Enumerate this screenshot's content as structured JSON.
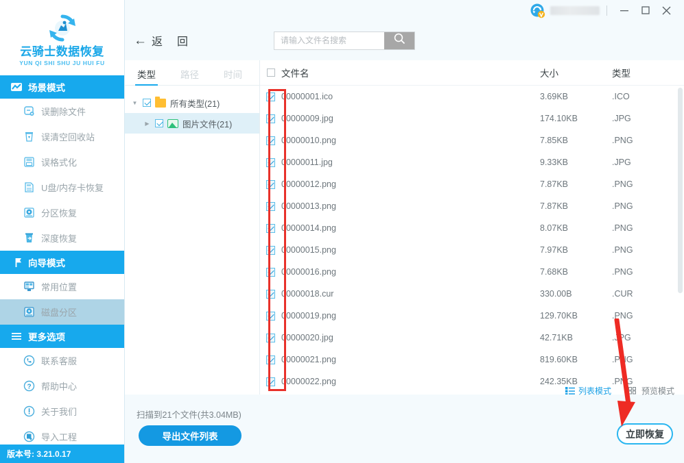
{
  "app": {
    "logo_title": "云骑士数据恢复",
    "logo_subtitle": "YUN QI SHI SHU JU HUI FU",
    "version": "版本号: 3.21.0.17"
  },
  "titlebar": {
    "minimize": "—",
    "maximize": "□",
    "close": "✕"
  },
  "sidebar": {
    "groups": [
      {
        "label": "场景模式",
        "icon": "scene-mode-icon",
        "items": [
          {
            "label": "误删除文件",
            "icon": "deleted-file-icon",
            "selected": false
          },
          {
            "label": "误清空回收站",
            "icon": "recycle-bin-icon",
            "selected": false
          },
          {
            "label": "误格式化",
            "icon": "format-icon",
            "selected": false
          },
          {
            "label": "U盘/内存卡恢复",
            "icon": "usb-card-icon",
            "selected": false
          },
          {
            "label": "分区恢复",
            "icon": "partition-recovery-icon",
            "selected": false
          },
          {
            "label": "深度恢复",
            "icon": "deep-recovery-icon",
            "selected": false
          }
        ]
      },
      {
        "label": "向导模式",
        "icon": "wizard-mode-icon",
        "items": [
          {
            "label": "常用位置",
            "icon": "common-location-icon",
            "selected": false
          },
          {
            "label": "磁盘分区",
            "icon": "disk-partition-icon",
            "selected": true
          }
        ]
      },
      {
        "label": "更多选项",
        "icon": "hamburger-icon",
        "items": [
          {
            "label": "联系客服",
            "icon": "phone-icon",
            "selected": false
          },
          {
            "label": "帮助中心",
            "icon": "question-icon",
            "selected": false
          },
          {
            "label": "关于我们",
            "icon": "info-icon",
            "selected": false
          },
          {
            "label": "导入工程",
            "icon": "import-project-icon",
            "selected": false
          }
        ]
      }
    ]
  },
  "toolbar": {
    "back_label": "返",
    "back_label2": "回",
    "search_placeholder": "请输入文件名搜索",
    "search_value": ""
  },
  "tree": {
    "tabs": [
      {
        "label": "类型",
        "active": true
      },
      {
        "label": "路径",
        "active": false
      },
      {
        "label": "时间",
        "active": false
      }
    ],
    "nodes": [
      {
        "label": "所有类型(21)",
        "level": 1,
        "icon": "folder-icon",
        "checked": true,
        "expanded": true,
        "selected": false
      },
      {
        "label": "图片文件(21)",
        "level": 2,
        "icon": "picture-icon",
        "checked": true,
        "expanded": false,
        "selected": true
      }
    ]
  },
  "filelist": {
    "columns": [
      "文件名",
      "大小",
      "类型"
    ],
    "header_checked": false,
    "rows": [
      {
        "name": "00000001.ico",
        "size": "3.69KB",
        "type": ".ICO",
        "checked": true
      },
      {
        "name": "00000009.jpg",
        "size": "174.10KB",
        "type": ".JPG",
        "checked": true
      },
      {
        "name": "00000010.png",
        "size": "7.85KB",
        "type": ".PNG",
        "checked": true
      },
      {
        "name": "00000011.jpg",
        "size": "9.33KB",
        "type": ".JPG",
        "checked": true
      },
      {
        "name": "00000012.png",
        "size": "7.87KB",
        "type": ".PNG",
        "checked": true
      },
      {
        "name": "00000013.png",
        "size": "7.87KB",
        "type": ".PNG",
        "checked": true
      },
      {
        "name": "00000014.png",
        "size": "8.07KB",
        "type": ".PNG",
        "checked": true
      },
      {
        "name": "00000015.png",
        "size": "7.97KB",
        "type": ".PNG",
        "checked": true
      },
      {
        "name": "00000016.png",
        "size": "7.68KB",
        "type": ".PNG",
        "checked": true
      },
      {
        "name": "00000018.cur",
        "size": "330.00B",
        "type": ".CUR",
        "checked": true
      },
      {
        "name": "00000019.png",
        "size": "129.70KB",
        "type": ".PNG",
        "checked": true
      },
      {
        "name": "00000020.jpg",
        "size": "42.71KB",
        "type": ".JPG",
        "checked": true
      },
      {
        "name": "00000021.png",
        "size": "819.60KB",
        "type": ".PNG",
        "checked": true
      },
      {
        "name": "00000022.png",
        "size": "242.35KB",
        "type": ".PNG",
        "checked": true
      }
    ]
  },
  "footer": {
    "scan_summary": "扫描到21个文件(共3.04MB)",
    "export_label": "导出文件列表",
    "list_mode_label": "列表模式",
    "preview_mode_label": "预览模式",
    "recover_label": "立即恢复"
  },
  "colors": {
    "accent": "#17a9ed",
    "header_bar": "#17a9ed",
    "selected_item": "#aed4e6",
    "annotation_red": "#e8312a",
    "recover_border": "#2ab6f0"
  }
}
